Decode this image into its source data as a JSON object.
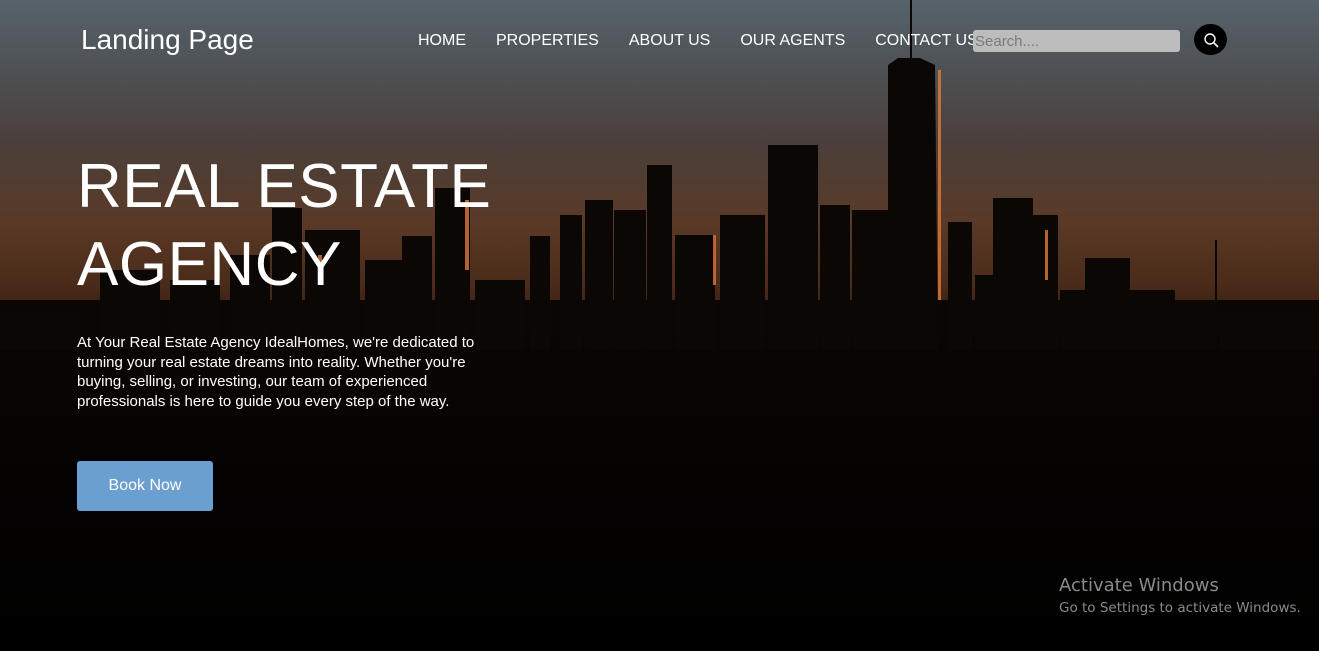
{
  "brand": {
    "title": "Landing Page"
  },
  "nav": {
    "items": [
      {
        "label": "HOME"
      },
      {
        "label": "PROPERTIES"
      },
      {
        "label": "ABOUT US"
      },
      {
        "label": "OUR AGENTS"
      },
      {
        "label": "CONTACT US"
      }
    ]
  },
  "search": {
    "placeholder": "Search....",
    "value": "",
    "icon": "search-icon"
  },
  "hero": {
    "headline_line1": "REAL ESTATE",
    "headline_line2": "AGENCY",
    "description": "At Your Real Estate Agency IdealHomes, we're dedicated to turning your real estate dreams into reality. Whether you're buying, selling, or investing, our team of experienced professionals is here to guide you every step of the way.",
    "button_label": "Book Now"
  },
  "watermark": {
    "title": "Activate Windows",
    "subtitle": "Go to Settings to activate Windows."
  },
  "colors": {
    "button_accent": "#6a9fd0",
    "search_bg": "#bdbcbc",
    "text": "#ffffff"
  }
}
